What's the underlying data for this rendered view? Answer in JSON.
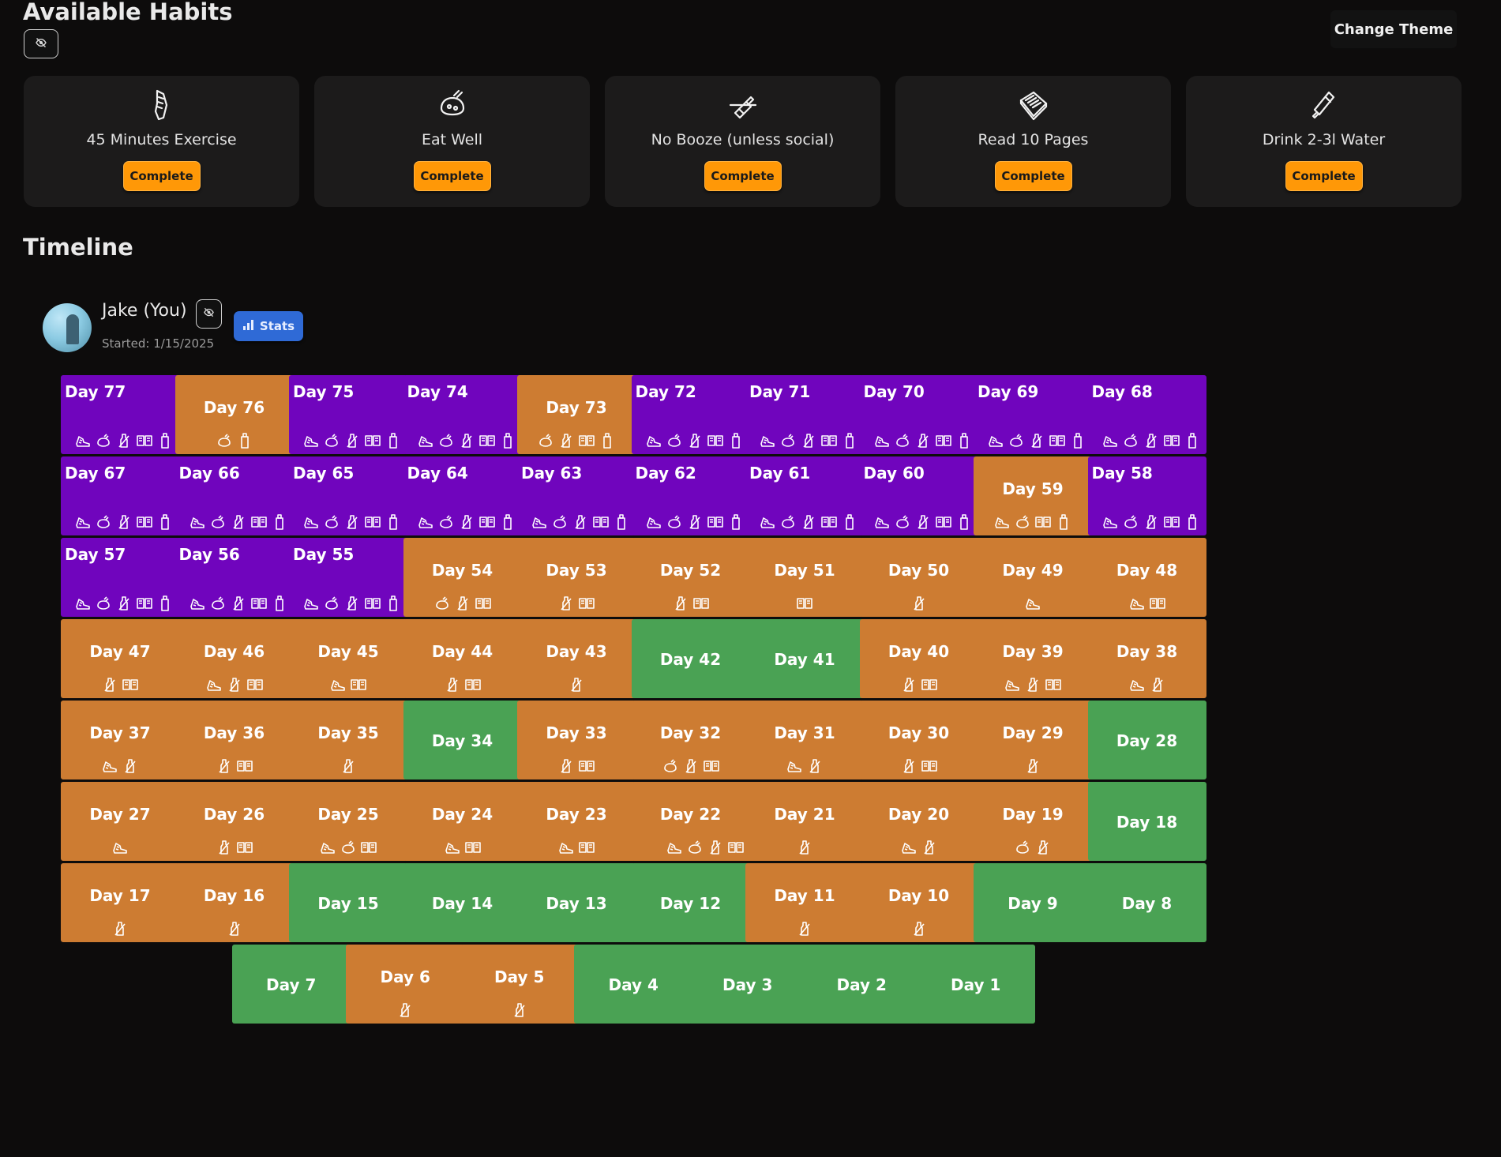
{
  "header": {
    "available_title": "Available Habits",
    "theme_button_label": "Change Theme",
    "timeline_title": "Timeline"
  },
  "colors": {
    "accent_orange": "#ff9807",
    "stats_blue": "#2f6ad6",
    "day_all_complete": "#7005bd",
    "day_partial": "#cd7c32",
    "day_none": "#4aa254"
  },
  "habits": [
    {
      "name": "45 Minutes Exercise",
      "icon": "running-shoe-icon",
      "button_label": "Complete"
    },
    {
      "name": "Eat Well",
      "icon": "fork-knife-food-icon",
      "button_label": "Complete"
    },
    {
      "name": "No Booze (unless social)",
      "icon": "no-bottle-icon",
      "button_label": "Complete"
    },
    {
      "name": "Read 10 Pages",
      "icon": "book-icon",
      "button_label": "Complete"
    },
    {
      "name": "Drink 2-3l Water",
      "icon": "water-bottle-icon",
      "button_label": "Complete"
    }
  ],
  "user": {
    "name": "Jake (You)",
    "started": "Started: 1/15/2025",
    "stats_label": "Stats"
  },
  "timeline": [
    {
      "label": "Day 77",
      "habits": [
        "exercise",
        "food",
        "booze",
        "read",
        "water"
      ]
    },
    {
      "label": "Day 76",
      "habits": [
        "food",
        "water"
      ]
    },
    {
      "label": "Day 75",
      "habits": [
        "exercise",
        "food",
        "booze",
        "read",
        "water"
      ]
    },
    {
      "label": "Day 74",
      "habits": [
        "exercise",
        "food",
        "booze",
        "read",
        "water"
      ]
    },
    {
      "label": "Day 73",
      "habits": [
        "food",
        "booze",
        "read",
        "water"
      ]
    },
    {
      "label": "Day 72",
      "habits": [
        "exercise",
        "food",
        "booze",
        "read",
        "water"
      ]
    },
    {
      "label": "Day 71",
      "habits": [
        "exercise",
        "food",
        "booze",
        "read",
        "water"
      ]
    },
    {
      "label": "Day 70",
      "habits": [
        "exercise",
        "food",
        "booze",
        "read",
        "water"
      ]
    },
    {
      "label": "Day 69",
      "habits": [
        "exercise",
        "food",
        "booze",
        "read",
        "water"
      ]
    },
    {
      "label": "Day 68",
      "habits": [
        "exercise",
        "food",
        "booze",
        "read",
        "water"
      ]
    },
    {
      "label": "Day 67",
      "habits": [
        "exercise",
        "food",
        "booze",
        "read",
        "water"
      ]
    },
    {
      "label": "Day 66",
      "habits": [
        "exercise",
        "food",
        "booze",
        "read",
        "water"
      ]
    },
    {
      "label": "Day 65",
      "habits": [
        "exercise",
        "food",
        "booze",
        "read",
        "water"
      ]
    },
    {
      "label": "Day 64",
      "habits": [
        "exercise",
        "food",
        "booze",
        "read",
        "water"
      ]
    },
    {
      "label": "Day 63",
      "habits": [
        "exercise",
        "food",
        "booze",
        "read",
        "water"
      ]
    },
    {
      "label": "Day 62",
      "habits": [
        "exercise",
        "food",
        "booze",
        "read",
        "water"
      ]
    },
    {
      "label": "Day 61",
      "habits": [
        "exercise",
        "food",
        "booze",
        "read",
        "water"
      ]
    },
    {
      "label": "Day 60",
      "habits": [
        "exercise",
        "food",
        "booze",
        "read",
        "water"
      ]
    },
    {
      "label": "Day 59",
      "habits": [
        "exercise",
        "food",
        "read",
        "water"
      ]
    },
    {
      "label": "Day 58",
      "habits": [
        "exercise",
        "food",
        "booze",
        "read",
        "water"
      ]
    },
    {
      "label": "Day 57",
      "habits": [
        "exercise",
        "food",
        "booze",
        "read",
        "water"
      ]
    },
    {
      "label": "Day 56",
      "habits": [
        "exercise",
        "food",
        "booze",
        "read",
        "water"
      ]
    },
    {
      "label": "Day 55",
      "habits": [
        "exercise",
        "food",
        "booze",
        "read",
        "water"
      ]
    },
    {
      "label": "Day 54",
      "habits": [
        "food",
        "booze",
        "read"
      ]
    },
    {
      "label": "Day 53",
      "habits": [
        "booze",
        "read"
      ]
    },
    {
      "label": "Day 52",
      "habits": [
        "booze",
        "read"
      ]
    },
    {
      "label": "Day 51",
      "habits": [
        "read"
      ]
    },
    {
      "label": "Day 50",
      "habits": [
        "booze"
      ]
    },
    {
      "label": "Day 49",
      "habits": [
        "exercise"
      ]
    },
    {
      "label": "Day 48",
      "habits": [
        "exercise",
        "read"
      ]
    },
    {
      "label": "Day 47",
      "habits": [
        "booze",
        "read"
      ]
    },
    {
      "label": "Day 46",
      "habits": [
        "exercise",
        "booze",
        "read"
      ]
    },
    {
      "label": "Day 45",
      "habits": [
        "exercise",
        "read"
      ]
    },
    {
      "label": "Day 44",
      "habits": [
        "booze",
        "read"
      ]
    },
    {
      "label": "Day 43",
      "habits": [
        "booze"
      ]
    },
    {
      "label": "Day 42",
      "habits": []
    },
    {
      "label": "Day 41",
      "habits": []
    },
    {
      "label": "Day 40",
      "habits": [
        "booze",
        "read"
      ]
    },
    {
      "label": "Day 39",
      "habits": [
        "exercise",
        "booze",
        "read"
      ]
    },
    {
      "label": "Day 38",
      "habits": [
        "exercise",
        "booze"
      ]
    },
    {
      "label": "Day 37",
      "habits": [
        "exercise",
        "booze"
      ]
    },
    {
      "label": "Day 36",
      "habits": [
        "booze",
        "read"
      ]
    },
    {
      "label": "Day 35",
      "habits": [
        "booze"
      ]
    },
    {
      "label": "Day 34",
      "habits": []
    },
    {
      "label": "Day 33",
      "habits": [
        "booze",
        "read"
      ]
    },
    {
      "label": "Day 32",
      "habits": [
        "food",
        "booze",
        "read"
      ]
    },
    {
      "label": "Day 31",
      "habits": [
        "exercise",
        "booze"
      ]
    },
    {
      "label": "Day 30",
      "habits": [
        "booze",
        "read"
      ]
    },
    {
      "label": "Day 29",
      "habits": [
        "booze"
      ]
    },
    {
      "label": "Day 28",
      "habits": []
    },
    {
      "label": "Day 27",
      "habits": [
        "exercise"
      ]
    },
    {
      "label": "Day 26",
      "habits": [
        "booze",
        "read"
      ]
    },
    {
      "label": "Day 25",
      "habits": [
        "exercise",
        "food",
        "read"
      ]
    },
    {
      "label": "Day 24",
      "habits": [
        "exercise",
        "read"
      ]
    },
    {
      "label": "Day 23",
      "habits": [
        "exercise",
        "read"
      ]
    },
    {
      "label": "Day 22",
      "habits": [
        "exercise",
        "food",
        "booze",
        "read"
      ]
    },
    {
      "label": "Day 21",
      "habits": [
        "booze"
      ]
    },
    {
      "label": "Day 20",
      "habits": [
        "exercise",
        "booze"
      ]
    },
    {
      "label": "Day 19",
      "habits": [
        "food",
        "booze"
      ]
    },
    {
      "label": "Day 18",
      "habits": []
    },
    {
      "label": "Day 17",
      "habits": [
        "booze"
      ]
    },
    {
      "label": "Day 16",
      "habits": [
        "booze"
      ]
    },
    {
      "label": "Day 15",
      "habits": []
    },
    {
      "label": "Day 14",
      "habits": []
    },
    {
      "label": "Day 13",
      "habits": []
    },
    {
      "label": "Day 12",
      "habits": []
    },
    {
      "label": "Day 11",
      "habits": [
        "booze"
      ]
    },
    {
      "label": "Day 10",
      "habits": [
        "booze"
      ]
    },
    {
      "label": "Day 9",
      "habits": []
    },
    {
      "label": "Day 8",
      "habits": []
    },
    {
      "label": "Day 7",
      "habits": []
    },
    {
      "label": "Day 6",
      "habits": [
        "booze"
      ]
    },
    {
      "label": "Day 5",
      "habits": [
        "booze"
      ]
    },
    {
      "label": "Day 4",
      "habits": []
    },
    {
      "label": "Day 3",
      "habits": []
    },
    {
      "label": "Day 2",
      "habits": []
    },
    {
      "label": "Day 1",
      "habits": []
    }
  ]
}
